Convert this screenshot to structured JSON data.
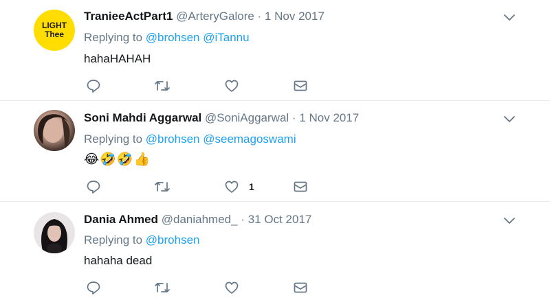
{
  "tweets": [
    {
      "name": "TranieeActPart1",
      "handle": "@ArteryGalore",
      "separator": "·",
      "date": "1 Nov 2017",
      "replying_label": "Replying to",
      "mentions": [
        "@brohsen",
        "@iTannu"
      ],
      "text": "hahaHAHAH",
      "avatar_text_line1": "LIGHT",
      "avatar_text_line2": "Thee",
      "avatar_color": "#ffdd00",
      "like_count": ""
    },
    {
      "name": "Soni Mahdi Aggarwal",
      "handle": "@SoniAggarwal",
      "separator": "·",
      "date": "1 Nov 2017",
      "replying_label": "Replying to",
      "mentions": [
        "@brohsen",
        "@seemagoswami"
      ],
      "text": "😂🤣🤣👍",
      "like_count": "1"
    },
    {
      "name": "Dania Ahmed",
      "handle": "@daniahmed_",
      "separator": "·",
      "date": "31 Oct 2017",
      "replying_label": "Replying to",
      "mentions": [
        "@brohsen"
      ],
      "text": "hahaha dead",
      "like_count": ""
    }
  ],
  "icons": {
    "reply": "reply-icon",
    "retweet": "retweet-icon",
    "like": "like-icon",
    "message": "direct-message-icon",
    "more": "chevron-down-icon"
  },
  "colors": {
    "link": "#1da1f2",
    "secondary_text": "#657786",
    "icon": "#657786"
  }
}
